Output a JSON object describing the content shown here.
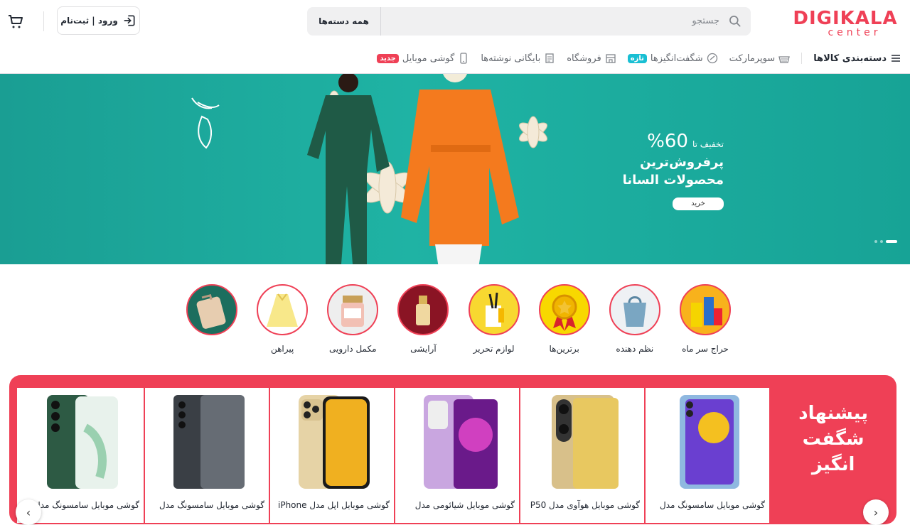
{
  "brand": {
    "logo_text": "DIGIKALA",
    "logo_sub": "center",
    "color": "#ef4056"
  },
  "search": {
    "placeholder": "جستجو",
    "category": "همه دسته‌ها"
  },
  "header": {
    "login_label": "ورود | ثبت‌نام"
  },
  "nav": {
    "items": [
      {
        "label": "دسته‌بندی کالاها",
        "icon": "menu-icon"
      },
      {
        "label": "سوپرمارکت",
        "icon": "basket-icon"
      },
      {
        "label": "شگفت‌انگیزها",
        "icon": "percent-icon",
        "badge": "تازه",
        "badge_color": "#19bfd3"
      },
      {
        "label": "فروشگاه",
        "icon": "store-icon"
      },
      {
        "label": "بایگانی نوشته‌ها",
        "icon": "document-icon"
      },
      {
        "label": "گوشی موبایل",
        "icon": "phone-icon",
        "badge": "جدید",
        "badge_color": "#ef4056"
      }
    ]
  },
  "hero": {
    "discount_prefix": "تخفیف تا",
    "discount_value": "60%",
    "line2": "پرفروش‌ترین",
    "line3": "محصولات السانا",
    "button": "خرید",
    "bg_color": "#1fb3a4"
  },
  "categories": [
    {
      "label": "حراج سر ماه",
      "icon": "grocery-icon"
    },
    {
      "label": "نظم دهنده",
      "icon": "storage-bag-icon"
    },
    {
      "label": "برترین‌ها",
      "icon": "medal-icon"
    },
    {
      "label": "لوازم تحریر",
      "icon": "stationery-icon"
    },
    {
      "label": "آرایشی",
      "icon": "perfume-icon"
    },
    {
      "label": "مکمل دارویی",
      "icon": "supplement-jar-icon"
    },
    {
      "label": "پیراهن",
      "icon": "dress-icon"
    },
    {
      "label": "",
      "icon": "suitcase-icon"
    }
  ],
  "amazing": {
    "title_line1": "پیشنهاد",
    "title_line2": "شگفت",
    "title_line3": "انگیز",
    "products": [
      {
        "title": "گوشی موبایل سامسونگ مدل",
        "image": "samsung-a73-phone",
        "c1": "#8fb8e0",
        "c2": "#6a3fd0"
      },
      {
        "title": "گوشی موبایل هوآوی مدل P50",
        "image": "huawei-p50-phone",
        "c1": "#d8c08a",
        "c2": "#b89a50"
      },
      {
        "title": "گوشی موبایل شیائومی مدل",
        "image": "xiaomi-note-phone",
        "c1": "#c9a6e0",
        "c2": "#a040c0"
      },
      {
        "title": "گوشی موبایل اپل مدل iPhone",
        "image": "iphone-13-pro-phone",
        "c1": "#e6d3a6",
        "c2": "#f0b020"
      },
      {
        "title": "گوشی موبایل سامسونگ مدل",
        "image": "galaxy-z-fold4-phone",
        "c1": "#3a3f45",
        "c2": "#666c74"
      },
      {
        "title": "گوشی موبایل سامسونگ مدل",
        "image": "galaxy-s22-phone",
        "c1": "#2d5a44",
        "c2": "#9ad0b0"
      }
    ]
  }
}
